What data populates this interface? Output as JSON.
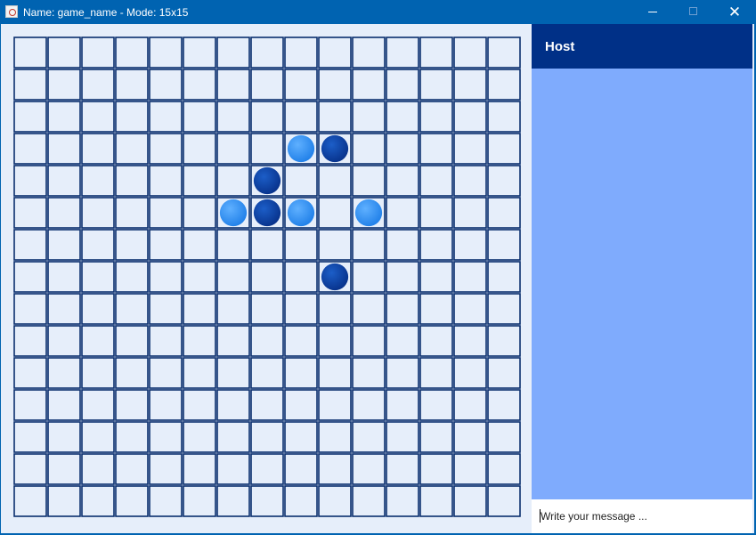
{
  "window": {
    "title": "Name: game_name - Mode: 15x15"
  },
  "board": {
    "rows": 15,
    "cols": 15,
    "grid_color": "#0b2f6e",
    "cell_color": "#e6eefa",
    "stones": [
      {
        "row": 3,
        "col": 8,
        "player": "light"
      },
      {
        "row": 3,
        "col": 9,
        "player": "dark"
      },
      {
        "row": 4,
        "col": 7,
        "player": "dark"
      },
      {
        "row": 5,
        "col": 6,
        "player": "light"
      },
      {
        "row": 5,
        "col": 7,
        "player": "dark"
      },
      {
        "row": 5,
        "col": 8,
        "player": "light"
      },
      {
        "row": 5,
        "col": 10,
        "player": "light"
      },
      {
        "row": 7,
        "col": 9,
        "player": "dark"
      }
    ],
    "colors": {
      "light": "#2f8ef7",
      "dark": "#0a3fa6"
    }
  },
  "sidebar": {
    "header": "Host",
    "header_color": "#003087",
    "chat_color": "#7fabfd",
    "input_placeholder": "Write your message ..."
  }
}
